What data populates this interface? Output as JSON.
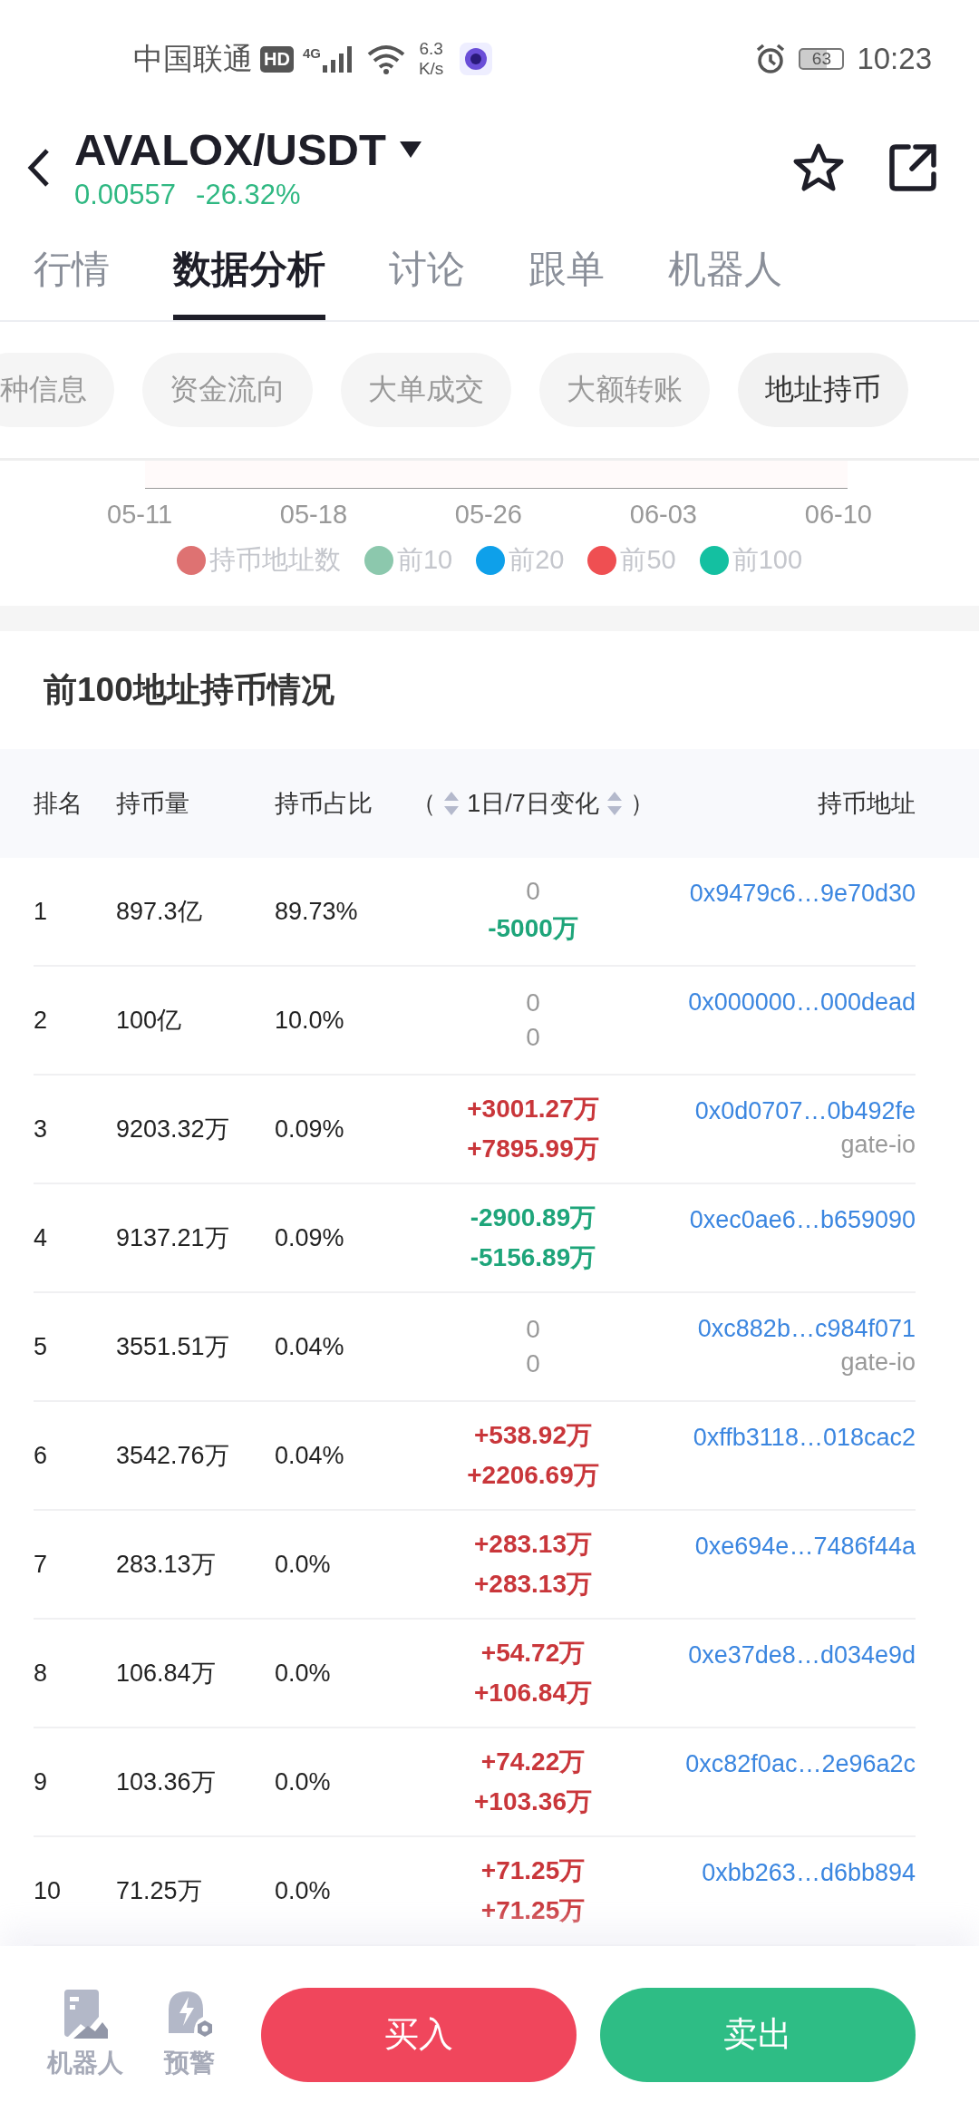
{
  "status_bar": {
    "carrier": "中国联通",
    "hd": "HD",
    "network": "4G",
    "speed_value": "6.3",
    "speed_unit": "K/s",
    "battery": "63",
    "time": "10:23"
  },
  "header": {
    "pair": "AVALOX/USDT",
    "price": "0.00557",
    "change": "-26.32%"
  },
  "tabs": [
    {
      "label": "行情",
      "selected": false
    },
    {
      "label": "数据分析",
      "selected": true
    },
    {
      "label": "讨论",
      "selected": false
    },
    {
      "label": "跟单",
      "selected": false
    },
    {
      "label": "机器人",
      "selected": false
    }
  ],
  "chips": [
    {
      "label": "种信息",
      "selected": false
    },
    {
      "label": "资金流向",
      "selected": false
    },
    {
      "label": "大单成交",
      "selected": false
    },
    {
      "label": "大额转账",
      "selected": false
    },
    {
      "label": "地址持币",
      "selected": true
    }
  ],
  "chart": {
    "xticks": [
      "05-11",
      "05-18",
      "05-26",
      "06-03",
      "06-10"
    ],
    "legend": [
      {
        "label": "持币地址数",
        "color": "#de7272"
      },
      {
        "label": "前10",
        "color": "#8cc8ad"
      },
      {
        "label": "前20",
        "color": "#0ea0ea"
      },
      {
        "label": "前50",
        "color": "#ef4f52"
      },
      {
        "label": "前100",
        "color": "#14c0a1"
      }
    ]
  },
  "holders": {
    "title": "前100地址持币情况",
    "columns": {
      "rank": "排名",
      "amount": "持币量",
      "share": "持币占比",
      "open": "（",
      "change": "1日/7日变化",
      "close": "）",
      "address": "持币地址"
    },
    "rows": [
      {
        "rank": "1",
        "amount": "897.3亿",
        "share": "89.73%",
        "change_1d": {
          "text": "0",
          "kind": "flat"
        },
        "change_7d": {
          "text": "-5000万",
          "kind": "down"
        },
        "address": "0x9479c6…9e70d30"
      },
      {
        "rank": "2",
        "amount": "100亿",
        "share": "10.0%",
        "change_1d": {
          "text": "0",
          "kind": "flat"
        },
        "change_7d": {
          "text": "0",
          "kind": "flat"
        },
        "address": "0x000000…000dead"
      },
      {
        "rank": "3",
        "amount": "9203.32万",
        "share": "0.09%",
        "change_1d": {
          "text": "+3001.27万",
          "kind": "up"
        },
        "change_7d": {
          "text": "+7895.99万",
          "kind": "up"
        },
        "address": "0x0d0707…0b492fe",
        "tag": "gate-io"
      },
      {
        "rank": "4",
        "amount": "9137.21万",
        "share": "0.09%",
        "change_1d": {
          "text": "-2900.89万",
          "kind": "down"
        },
        "change_7d": {
          "text": "-5156.89万",
          "kind": "down"
        },
        "address": "0xec0ae6…b659090"
      },
      {
        "rank": "5",
        "amount": "3551.51万",
        "share": "0.04%",
        "change_1d": {
          "text": "0",
          "kind": "flat"
        },
        "change_7d": {
          "text": "0",
          "kind": "flat"
        },
        "address": "0xc882b…c984f071",
        "tag": "gate-io"
      },
      {
        "rank": "6",
        "amount": "3542.76万",
        "share": "0.04%",
        "change_1d": {
          "text": "+538.92万",
          "kind": "up"
        },
        "change_7d": {
          "text": "+2206.69万",
          "kind": "up"
        },
        "address": "0xffb3118…018cac2"
      },
      {
        "rank": "7",
        "amount": "283.13万",
        "share": "0.0%",
        "change_1d": {
          "text": "+283.13万",
          "kind": "up"
        },
        "change_7d": {
          "text": "+283.13万",
          "kind": "up"
        },
        "address": "0xe694e…7486f44a"
      },
      {
        "rank": "8",
        "amount": "106.84万",
        "share": "0.0%",
        "change_1d": {
          "text": "+54.72万",
          "kind": "up"
        },
        "change_7d": {
          "text": "+106.84万",
          "kind": "up"
        },
        "address": "0xe37de8…d034e9d"
      },
      {
        "rank": "9",
        "amount": "103.36万",
        "share": "0.0%",
        "change_1d": {
          "text": "+74.22万",
          "kind": "up"
        },
        "change_7d": {
          "text": "+103.36万",
          "kind": "up"
        },
        "address": "0xc82f0ac…2e96a2c"
      },
      {
        "rank": "10",
        "amount": "71.25万",
        "share": "0.0%",
        "change_1d": {
          "text": "+71.25万",
          "kind": "up"
        },
        "change_7d": {
          "text": "+71.25万",
          "kind": "up"
        },
        "address": "0xbb263…d6bb894"
      }
    ]
  },
  "bottom_bar": {
    "robot": "机器人",
    "alert": "预警",
    "buy": "买入",
    "sell": "卖出"
  }
}
